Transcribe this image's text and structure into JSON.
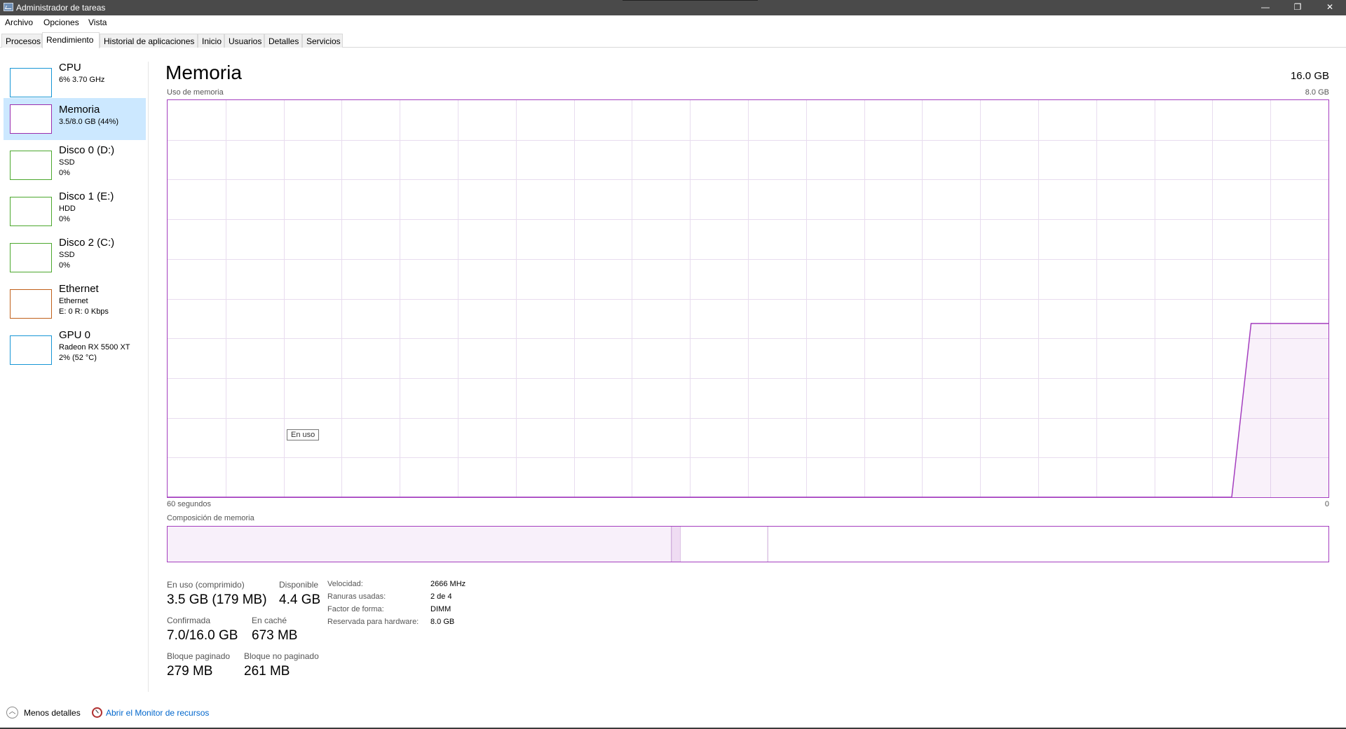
{
  "window": {
    "title": "Administrador de tareas",
    "minimize": "—",
    "maximize": "❐",
    "close": "✕"
  },
  "menu": [
    "Archivo",
    "Opciones",
    "Vista"
  ],
  "tabs": [
    "Procesos",
    "Rendimiento",
    "Historial de aplicaciones",
    "Inicio",
    "Usuarios",
    "Detalles",
    "Servicios"
  ],
  "active_tab": "Rendimiento",
  "sidebar": [
    {
      "name": "CPU",
      "line1": "6% 3.70 GHz",
      "line2": "",
      "color": "#1796d6"
    },
    {
      "name": "Memoria",
      "line1": "3.5/8.0 GB (44%)",
      "line2": "",
      "color": "#9b2fae",
      "selected": true
    },
    {
      "name": "Disco 0 (D:)",
      "line1": "SSD",
      "line2": "0%",
      "color": "#4ca82e"
    },
    {
      "name": "Disco 1 (E:)",
      "line1": "HDD",
      "line2": "0%",
      "color": "#4ca82e"
    },
    {
      "name": "Disco 2 (C:)",
      "line1": "SSD",
      "line2": "0%",
      "color": "#4ca82e"
    },
    {
      "name": "Ethernet",
      "line1": "Ethernet",
      "line2": "E: 0 R: 0 Kbps",
      "color": "#c0601a"
    },
    {
      "name": "GPU 0",
      "line1": "Radeon RX 5500 XT",
      "line2": "2% (52 °C)",
      "color": "#1796d6"
    }
  ],
  "main": {
    "title": "Memoria",
    "total": "16.0 GB",
    "graph_label": "Uso de memoria",
    "graph_max": "8.0 GB",
    "graph_left": "60 segundos",
    "graph_right": "0",
    "tooltip": "En uso",
    "composition_label": "Composición de memoria",
    "accent": "#a43ebf"
  },
  "chart_data": {
    "type": "area",
    "ylim": [
      0,
      8.0
    ],
    "xlim": [
      60,
      0
    ],
    "x": [
      60,
      5,
      4,
      0
    ],
    "values": [
      0,
      0,
      3.5,
      3.5
    ]
  },
  "composition": {
    "in_use_fraction": 0.434,
    "modified_fraction": 0.008,
    "standby_fraction": 0.075
  },
  "stats": {
    "in_use_label": "En uso (comprimido)",
    "in_use_value": "3.5 GB (179 MB)",
    "available_label": "Disponible",
    "available_value": "4.4 GB",
    "committed_label": "Confirmada",
    "committed_value": "7.0/16.0 GB",
    "cached_label": "En caché",
    "cached_value": "673 MB",
    "paged_label": "Bloque paginado",
    "paged_value": "279 MB",
    "nonpaged_label": "Bloque no paginado",
    "nonpaged_value": "261 MB"
  },
  "details": [
    {
      "label": "Velocidad:",
      "value": "2666 MHz"
    },
    {
      "label": "Ranuras usadas:",
      "value": "2 de 4"
    },
    {
      "label": "Factor de forma:",
      "value": "DIMM"
    },
    {
      "label": "Reservada para hardware:",
      "value": "8.0 GB"
    }
  ],
  "footer": {
    "less_details": "Menos detalles",
    "open_monitor": "Abrir el Monitor de recursos"
  }
}
